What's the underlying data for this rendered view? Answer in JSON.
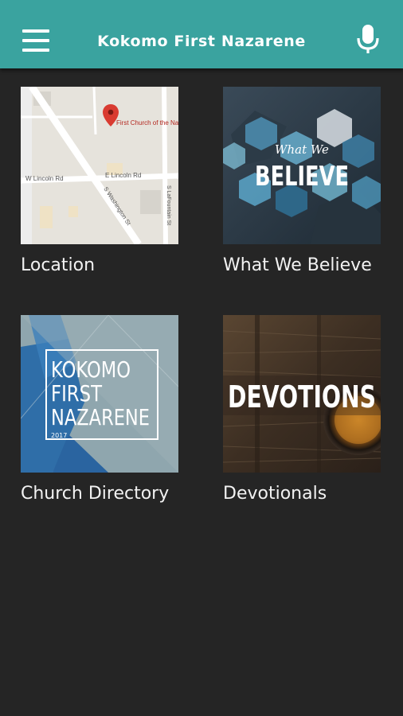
{
  "header": {
    "title": "Kokomo First Nazarene",
    "menu_icon": "hamburger-menu-icon",
    "voice_icon": "microphone-icon",
    "accent_color": "#3aa39f"
  },
  "background_color": "#252525",
  "tiles": [
    {
      "label": "Location",
      "map": {
        "place_name": "First Church of the Nazarene",
        "street_labels": [
          "W Lincoln Rd",
          "E Lincoln Rd",
          "S Washington St",
          "S LaFountain St"
        ]
      }
    },
    {
      "label": "What We Believe",
      "art_text": [
        "What We",
        "BELIEVE"
      ]
    },
    {
      "label": "Church Directory",
      "art_text": [
        "KOKOMO",
        "FIRST",
        "NAZARENE",
        "2017"
      ]
    },
    {
      "label": "Devotionals",
      "art_text": [
        "DEVOTIONS"
      ]
    }
  ]
}
